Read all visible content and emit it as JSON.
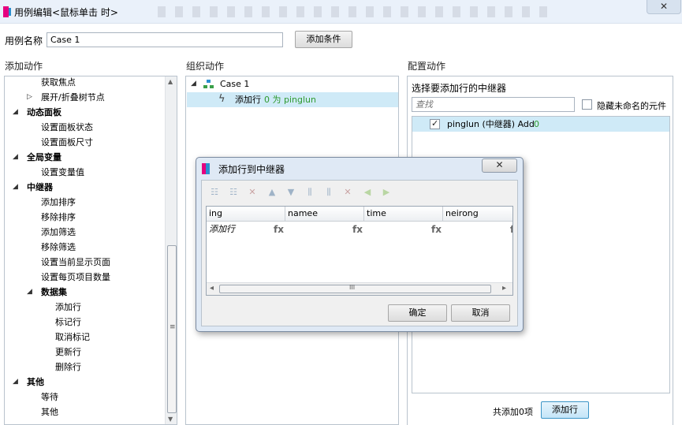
{
  "window": {
    "title": "用例编辑<鼠标单击 时>",
    "close_glyph": "✕"
  },
  "case_name": {
    "label": "用例名称",
    "value": "Case 1",
    "add_condition_button": "添加条件"
  },
  "left": {
    "title": "添加动作",
    "items": [
      {
        "text": "获取焦点"
      },
      {
        "text": "展开/折叠树节点",
        "toggle": "▷"
      },
      {
        "text": "动态面板",
        "toggle": "◢"
      },
      {
        "text": "设置面板状态"
      },
      {
        "text": "设置面板尺寸"
      },
      {
        "text": "全局变量",
        "toggle": "◢"
      },
      {
        "text": "设置变量值"
      },
      {
        "text": "中继器",
        "toggle": "◢"
      },
      {
        "text": "添加排序"
      },
      {
        "text": "移除排序"
      },
      {
        "text": "添加筛选"
      },
      {
        "text": "移除筛选"
      },
      {
        "text": "设置当前显示页面"
      },
      {
        "text": "设置每页项目数量"
      },
      {
        "text": "数据集",
        "toggle": "◢"
      },
      {
        "text": "添加行"
      },
      {
        "text": "标记行"
      },
      {
        "text": "取消标记"
      },
      {
        "text": "更新行"
      },
      {
        "text": "删除行"
      },
      {
        "text": "其他",
        "toggle": "◢"
      },
      {
        "text": "等待"
      },
      {
        "text": "其他"
      }
    ],
    "scroll_up": "▲",
    "scroll_down": "▼",
    "scroll_grip": "≡"
  },
  "middle": {
    "title": "组织动作",
    "case_label": "Case 1",
    "case_toggle": "◢",
    "action_prefix": "添加行",
    "action_detail": "0 为 pinglun"
  },
  "right": {
    "title": "配置动作",
    "subtitle": "选择要添加行的中继器",
    "search_placeholder": "查找",
    "hide_unnamed_label": "隐藏未命名的元件",
    "repeater_name": "pinglun (中继器) Add",
    "repeater_count": "0",
    "footer_count": "共添加0项",
    "add_row_button": "添加行"
  },
  "dialog": {
    "title": "添加行到中继器",
    "close_glyph": "✕",
    "columns": [
      "ing",
      "namee",
      "time",
      "neirong"
    ],
    "row": {
      "first": "添加行",
      "fx": [
        "fx",
        "fx",
        "fx",
        "f"
      ]
    },
    "hscroll_left": "◂",
    "hscroll_right": "▸",
    "hscroll_grip": "III",
    "ok_button": "确定",
    "cancel_button": "取消"
  },
  "colors": {
    "selection": "#cfeaf7",
    "accent_green": "#2f9a2f",
    "dialog_bg": "#dfe9f5",
    "brand_pink": "#e5007f"
  }
}
